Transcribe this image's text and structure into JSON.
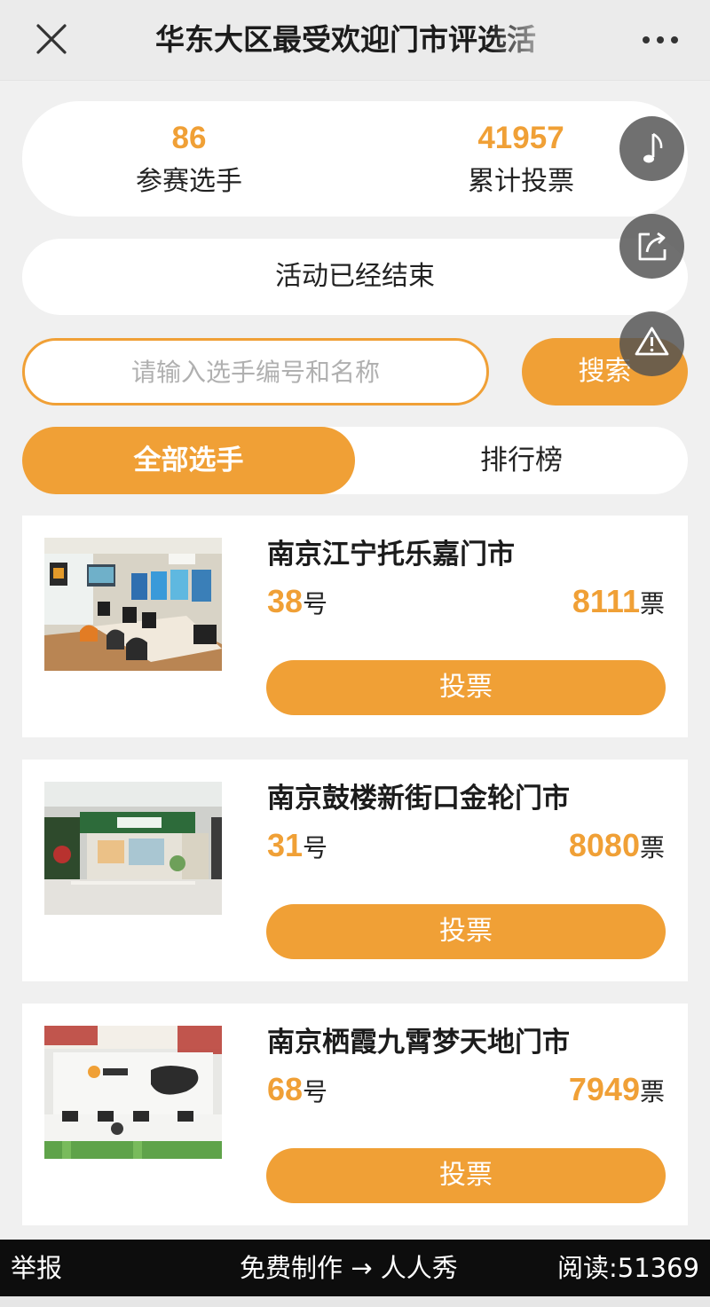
{
  "header": {
    "title": "华东大区最受欢迎门市评选活",
    "close_icon": "close-icon",
    "more_icon": "more-icon"
  },
  "stats": {
    "players_count": "86",
    "players_label": "参赛选手",
    "votes_count": "41957",
    "votes_label": "累计投票"
  },
  "status_text": "活动已经结束",
  "search": {
    "placeholder": "请输入选手编号和名称",
    "button_label": "搜索"
  },
  "tabs": [
    {
      "label": "全部选手",
      "active": true
    },
    {
      "label": "排行榜",
      "active": false
    }
  ],
  "floating_buttons": [
    "music-note-icon",
    "share-icon",
    "warning-icon"
  ],
  "entries": [
    {
      "name": "南京江宁托乐嘉门市",
      "number": "38",
      "number_suffix": "号",
      "votes": "8111",
      "votes_suffix": "票",
      "vote_button": "投票",
      "photo": "office-interior-photo"
    },
    {
      "name": "南京鼓楼新街口金轮门市",
      "number": "31",
      "number_suffix": "号",
      "votes": "8080",
      "votes_suffix": "票",
      "vote_button": "投票",
      "photo": "storefront-photo"
    },
    {
      "name": "南京栖霞九霄梦天地门市",
      "number": "68",
      "number_suffix": "号",
      "votes": "7949",
      "votes_suffix": "票",
      "vote_button": "投票",
      "photo": "service-counter-photo"
    }
  ],
  "footer": {
    "report": "举报",
    "make_free": "免费制作 → 人人秀",
    "reads": "阅读:51369"
  },
  "colors": {
    "accent": "#f0a036",
    "footer_bg": "#0d0d0d",
    "page_bg": "#f0f0f0"
  }
}
